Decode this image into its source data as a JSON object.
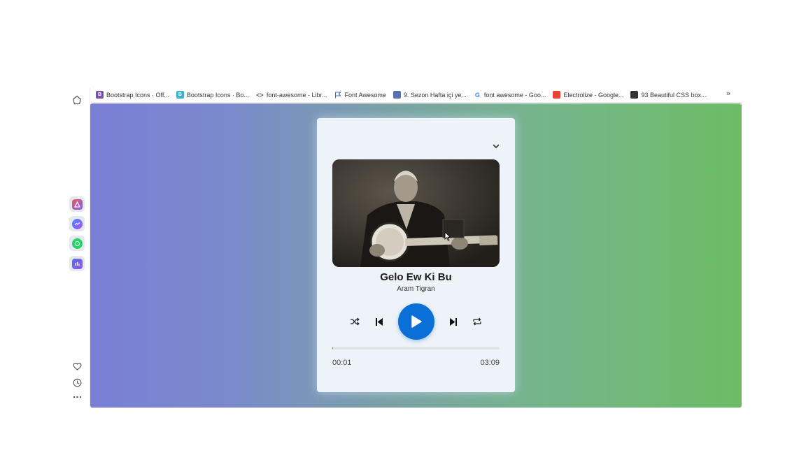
{
  "bookmarks": [
    {
      "label": "Bootstrap Icons · Off...",
      "icon": "bootstrap-icon",
      "color": "#7952b3",
      "glyph": "B"
    },
    {
      "label": "Bootstrap Icons · Bo...",
      "icon": "bootstrap-page-icon",
      "color": "#3bb2d0",
      "glyph": "B"
    },
    {
      "label": "font-awesome - Libr...",
      "icon": "code-icon",
      "color": "",
      "glyph": "<>"
    },
    {
      "label": "Font Awesome",
      "icon": "flag-icon",
      "color": "",
      "glyph": ""
    },
    {
      "label": "9. Sezon Hafta içi ye...",
      "icon": "site-icon",
      "color": "#5a6fb0",
      "glyph": ""
    },
    {
      "label": "font awesome - Goo...",
      "icon": "google-icon",
      "color": "",
      "glyph": "G"
    },
    {
      "label": "Electrolize - Google...",
      "icon": "google-fonts-icon",
      "color": "#ea4335",
      "glyph": ""
    },
    {
      "label": "93 Beautiful CSS box...",
      "icon": "site-icon",
      "color": "#333333",
      "glyph": ""
    }
  ],
  "more_bookmarks": "»",
  "player": {
    "title": "Gelo Ew Ki Bu",
    "artist": "Aram Tigran",
    "current_time": "00:01",
    "duration": "03:09",
    "progress_fraction": 0.005
  },
  "colors": {
    "gradient_start": "#7a7fd6",
    "gradient_end": "#6cbc66",
    "play_button": "#0a6fd6",
    "card_bg": "#eef3f9"
  }
}
